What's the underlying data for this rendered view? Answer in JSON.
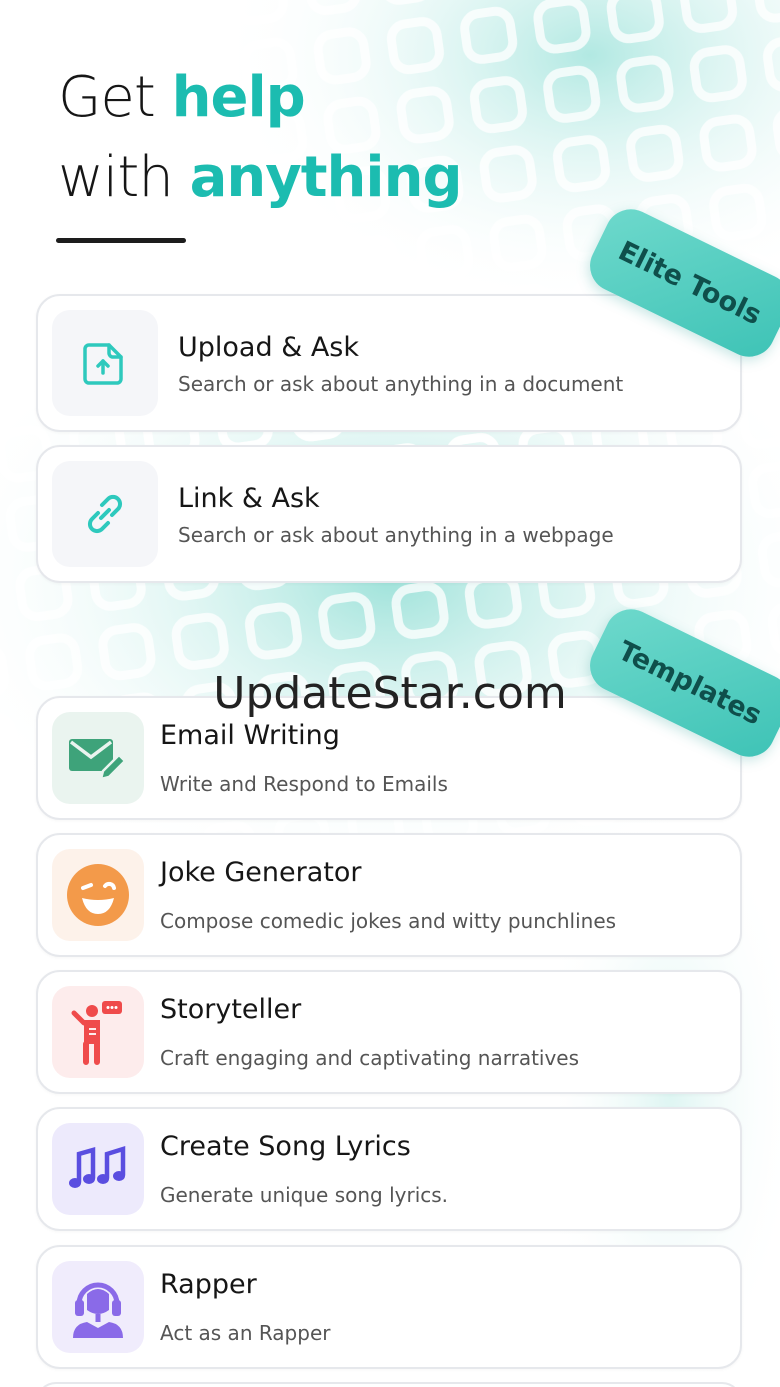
{
  "headline": {
    "line1_plain": "Get ",
    "line1_accent": "help",
    "line2_plain": "with ",
    "line2_accent": "anything"
  },
  "colors": {
    "accent": "#1cbcb0",
    "ribbon": "#4fcbbf",
    "email_icon": "#3ea37a",
    "joke_icon": "#f39a4a",
    "story_icon": "#ef4b4b",
    "music_icon": "#5a4ee0",
    "rapper_icon": "#8a6ae8"
  },
  "ribbons": {
    "elite": "Elite Tools",
    "templates": "Templates"
  },
  "tools": [
    {
      "title": "Upload & Ask",
      "subtitle": "Search or ask about anything in a document",
      "icon": "upload-file-icon"
    },
    {
      "title": "Link & Ask",
      "subtitle": "Search or ask about anything in a webpage",
      "icon": "link-icon"
    }
  ],
  "templates": [
    {
      "title": "Email Writing",
      "subtitle": "Write and Respond to Emails",
      "icon": "email-write-icon"
    },
    {
      "title": "Joke Generator",
      "subtitle": "Compose comedic jokes and witty punchlines",
      "icon": "winking-face-icon"
    },
    {
      "title": "Storyteller",
      "subtitle": "Craft engaging and captivating narratives",
      "icon": "storyteller-icon"
    },
    {
      "title": "Create Song Lyrics",
      "subtitle": "Generate unique song lyrics.",
      "icon": "music-notes-icon"
    },
    {
      "title": "Rapper",
      "subtitle": "Act as an Rapper",
      "icon": "rapper-icon"
    }
  ],
  "watermark": "UpdateStar.com"
}
